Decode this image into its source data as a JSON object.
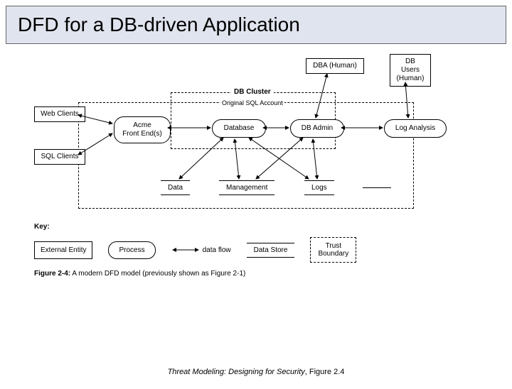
{
  "title": "DFD for a DB-driven Application",
  "entities": {
    "web_clients": "Web Clients",
    "sql_clients": "SQL Clients",
    "dba_human": "DBA (Human)",
    "db_users_human": "DB\nUsers\n(Human)"
  },
  "processes": {
    "acme_front_end": "Acme\nFront End(s)",
    "database": "Database",
    "db_admin": "DB Admin",
    "log_analysis": "Log Analysis"
  },
  "datastores": {
    "data": "Data",
    "management": "Management",
    "logs": "Logs"
  },
  "boundaries": {
    "db_cluster": "DB Cluster",
    "original_sql": "Original SQL Account"
  },
  "key": {
    "label": "Key:",
    "external_entity": "External Entity",
    "process": "Process",
    "data_flow": "data flow",
    "data_store": "Data Store",
    "trust_boundary": "Trust\nBoundary"
  },
  "figure_caption": {
    "prefix": "Figure 2-4:",
    "text": " A modern DFD model (previously shown as Figure 2-1)"
  },
  "footer": {
    "source": "Threat Modeling: Designing for Security",
    "suffix": ", Figure 2.4"
  }
}
